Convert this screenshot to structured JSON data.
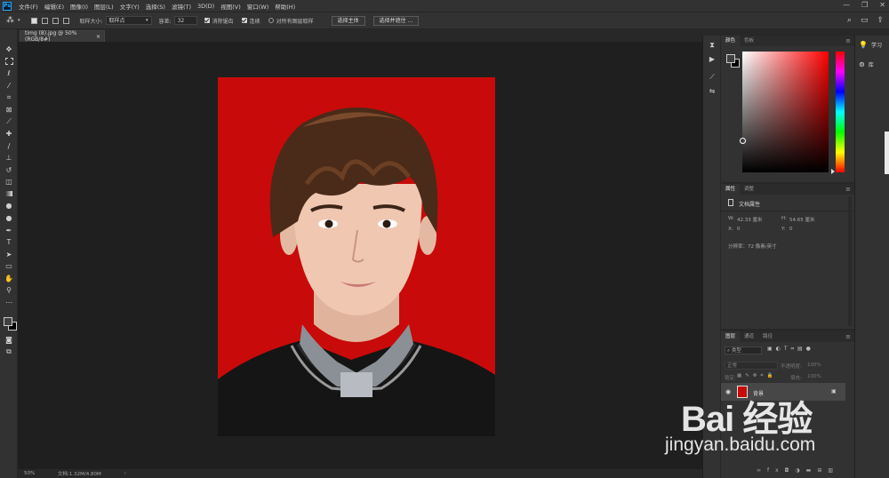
{
  "app": {
    "logo": "Ps"
  },
  "menu": [
    "文件(F)",
    "编辑(E)",
    "图像(I)",
    "图层(L)",
    "文字(Y)",
    "选择(S)",
    "滤镜(T)",
    "3D(D)",
    "视图(V)",
    "窗口(W)",
    "帮助(H)"
  ],
  "window_controls": {
    "minimize": "—",
    "restore": "❐",
    "close": "✕"
  },
  "options": {
    "sample_size_label": "取样大小:",
    "sample_size_value": "取样点",
    "tolerance_label": "容差:",
    "tolerance_value": "32",
    "antialias_label": "消除锯齿",
    "antialias_checked": true,
    "contiguous_label": "连续",
    "contiguous_checked": true,
    "sample_all_label": "对所有图层取样",
    "sample_all_checked": false,
    "select_subject_btn": "选择主体",
    "select_mask_btn": "选择并遮住 ..."
  },
  "document": {
    "tab_title": "timg (8).jpg @ 50%(RGB/8#)",
    "close_glyph": "×"
  },
  "status": {
    "zoom": "50%",
    "doc_info": "文档:1.32M/4.80M",
    "arrow": "›"
  },
  "color_panel": {
    "tabs": [
      "颜色",
      "色板"
    ],
    "hue": "#ff0000"
  },
  "properties_panel": {
    "tabs": [
      "属性",
      "调整"
    ],
    "title": "文档属性",
    "w_label": "W:",
    "w_value": "42.33 厘米",
    "h_label": "H:",
    "h_value": "54.65 厘米",
    "x_label": "X:",
    "x_value": "0",
    "y_label": "Y:",
    "y_value": "0",
    "resolution": "分辨率：72 像素/英寸"
  },
  "layers_panel": {
    "tabs": [
      "图层",
      "通道",
      "路径"
    ],
    "filter_label": "类型",
    "blend_mode": "正常",
    "opacity_label": "不透明度:",
    "opacity_value": "100%",
    "lock_label": "锁定:",
    "fill_label": "填充:",
    "fill_value": "100%",
    "layer_name": "背景"
  },
  "learn_panel": {
    "items": [
      "学习",
      "库"
    ]
  },
  "watermark": {
    "brand": "Bai 经验",
    "url": "jingyan.baidu.com"
  },
  "colors": {
    "photo_background": "#c80a0a",
    "foreground": "#404040",
    "background": "#000000"
  }
}
